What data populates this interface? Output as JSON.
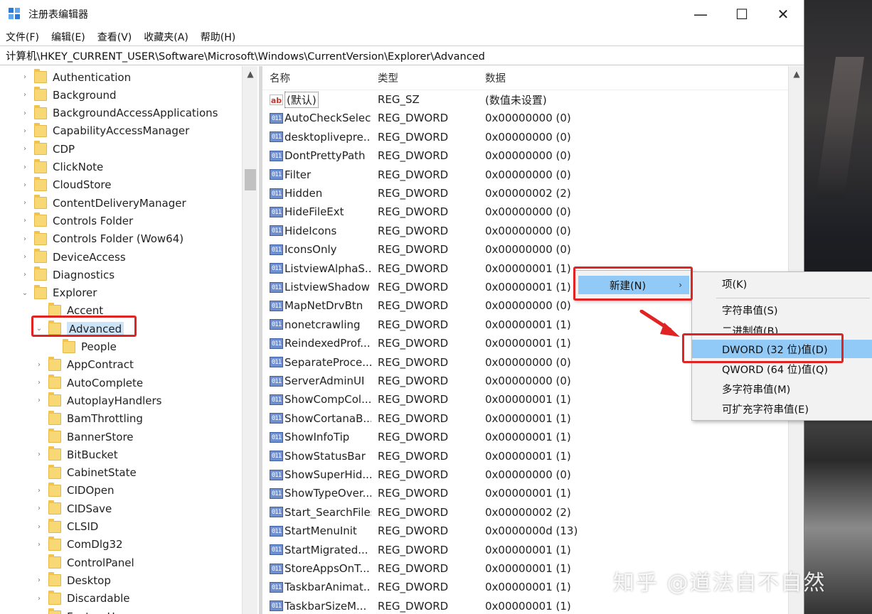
{
  "window": {
    "title": "注册表编辑器",
    "controls": [
      "—",
      "☐",
      "✕"
    ]
  },
  "menubar": [
    "文件(F)",
    "编辑(E)",
    "查看(V)",
    "收藏夹(A)",
    "帮助(H)"
  ],
  "address": "计算机\\HKEY_CURRENT_USER\\Software\\Microsoft\\Windows\\CurrentVersion\\Explorer\\Advanced",
  "tree": [
    {
      "label": "Authentication",
      "level": 1,
      "arrow": "›"
    },
    {
      "label": "Background",
      "level": 1,
      "arrow": "›"
    },
    {
      "label": "BackgroundAccessApplications",
      "level": 1,
      "arrow": "›"
    },
    {
      "label": "CapabilityAccessManager",
      "level": 1,
      "arrow": "›"
    },
    {
      "label": "CDP",
      "level": 1,
      "arrow": "›"
    },
    {
      "label": "ClickNote",
      "level": 1,
      "arrow": "›"
    },
    {
      "label": "CloudStore",
      "level": 1,
      "arrow": "›"
    },
    {
      "label": "ContentDeliveryManager",
      "level": 1,
      "arrow": "›"
    },
    {
      "label": "Controls Folder",
      "level": 1,
      "arrow": "›"
    },
    {
      "label": "Controls Folder (Wow64)",
      "level": 1,
      "arrow": "›"
    },
    {
      "label": "DeviceAccess",
      "level": 1,
      "arrow": "›"
    },
    {
      "label": "Diagnostics",
      "level": 1,
      "arrow": "›"
    },
    {
      "label": "Explorer",
      "level": 1,
      "arrow": "⌄"
    },
    {
      "label": "Accent",
      "level": 2,
      "arrow": ""
    },
    {
      "label": "Advanced",
      "level": 2,
      "arrow": "⌄"
    },
    {
      "label": "People",
      "level": 3,
      "arrow": ""
    },
    {
      "label": "AppContract",
      "level": 2,
      "arrow": "›"
    },
    {
      "label": "AutoComplete",
      "level": 2,
      "arrow": "›"
    },
    {
      "label": "AutoplayHandlers",
      "level": 2,
      "arrow": "›"
    },
    {
      "label": "BamThrottling",
      "level": 2,
      "arrow": ""
    },
    {
      "label": "BannerStore",
      "level": 2,
      "arrow": ""
    },
    {
      "label": "BitBucket",
      "level": 2,
      "arrow": "›"
    },
    {
      "label": "CabinetState",
      "level": 2,
      "arrow": ""
    },
    {
      "label": "CIDOpen",
      "level": 2,
      "arrow": "›"
    },
    {
      "label": "CIDSave",
      "level": 2,
      "arrow": "›"
    },
    {
      "label": "CLSID",
      "level": 2,
      "arrow": "›"
    },
    {
      "label": "ComDlg32",
      "level": 2,
      "arrow": "›"
    },
    {
      "label": "ControlPanel",
      "level": 2,
      "arrow": ""
    },
    {
      "label": "Desktop",
      "level": 2,
      "arrow": "›"
    },
    {
      "label": "Discardable",
      "level": 2,
      "arrow": "›"
    },
    {
      "label": "FeatureUsage",
      "level": 2,
      "arrow": "›"
    }
  ],
  "columns": {
    "name": "名称",
    "type": "类型",
    "data": "数据"
  },
  "values": [
    {
      "icon": "sz",
      "name": "(默认)",
      "type": "REG_SZ",
      "data": "(数值未设置)"
    },
    {
      "icon": "dword",
      "name": "AutoCheckSelect",
      "type": "REG_DWORD",
      "data": "0x00000000 (0)"
    },
    {
      "icon": "dword",
      "name": "desktoplivepre...",
      "type": "REG_DWORD",
      "data": "0x00000000 (0)"
    },
    {
      "icon": "dword",
      "name": "DontPrettyPath",
      "type": "REG_DWORD",
      "data": "0x00000000 (0)"
    },
    {
      "icon": "dword",
      "name": "Filter",
      "type": "REG_DWORD",
      "data": "0x00000000 (0)"
    },
    {
      "icon": "dword",
      "name": "Hidden",
      "type": "REG_DWORD",
      "data": "0x00000002 (2)"
    },
    {
      "icon": "dword",
      "name": "HideFileExt",
      "type": "REG_DWORD",
      "data": "0x00000000 (0)"
    },
    {
      "icon": "dword",
      "name": "HideIcons",
      "type": "REG_DWORD",
      "data": "0x00000000 (0)"
    },
    {
      "icon": "dword",
      "name": "IconsOnly",
      "type": "REG_DWORD",
      "data": "0x00000000 (0)"
    },
    {
      "icon": "dword",
      "name": "ListviewAlphaS...",
      "type": "REG_DWORD",
      "data": "0x00000001 (1)"
    },
    {
      "icon": "dword",
      "name": "ListviewShadow",
      "type": "REG_DWORD",
      "data": "0x00000001 (1)"
    },
    {
      "icon": "dword",
      "name": "MapNetDrvBtn",
      "type": "REG_DWORD",
      "data": "0x00000000 (0)"
    },
    {
      "icon": "dword",
      "name": "nonetcrawling",
      "type": "REG_DWORD",
      "data": "0x00000001 (1)"
    },
    {
      "icon": "dword",
      "name": "ReindexedProf...",
      "type": "REG_DWORD",
      "data": "0x00000001 (1)"
    },
    {
      "icon": "dword",
      "name": "SeparateProce...",
      "type": "REG_DWORD",
      "data": "0x00000000 (0)"
    },
    {
      "icon": "dword",
      "name": "ServerAdminUI",
      "type": "REG_DWORD",
      "data": "0x00000000 (0)"
    },
    {
      "icon": "dword",
      "name": "ShowCompCol...",
      "type": "REG_DWORD",
      "data": "0x00000001 (1)"
    },
    {
      "icon": "dword",
      "name": "ShowCortanaB...",
      "type": "REG_DWORD",
      "data": "0x00000001 (1)"
    },
    {
      "icon": "dword",
      "name": "ShowInfoTip",
      "type": "REG_DWORD",
      "data": "0x00000001 (1)"
    },
    {
      "icon": "dword",
      "name": "ShowStatusBar",
      "type": "REG_DWORD",
      "data": "0x00000001 (1)"
    },
    {
      "icon": "dword",
      "name": "ShowSuperHid...",
      "type": "REG_DWORD",
      "data": "0x00000000 (0)"
    },
    {
      "icon": "dword",
      "name": "ShowTypeOver...",
      "type": "REG_DWORD",
      "data": "0x00000001 (1)"
    },
    {
      "icon": "dword",
      "name": "Start_SearchFiles",
      "type": "REG_DWORD",
      "data": "0x00000002 (2)"
    },
    {
      "icon": "dword",
      "name": "StartMenuInit",
      "type": "REG_DWORD",
      "data": "0x0000000d (13)"
    },
    {
      "icon": "dword",
      "name": "StartMigrated...",
      "type": "REG_DWORD",
      "data": "0x00000001 (1)"
    },
    {
      "icon": "dword",
      "name": "StoreAppsOnT...",
      "type": "REG_DWORD",
      "data": "0x00000001 (1)"
    },
    {
      "icon": "dword",
      "name": "TaskbarAnimat...",
      "type": "REG_DWORD",
      "data": "0x00000001 (1)"
    },
    {
      "icon": "dword",
      "name": "TaskbarSizeM...",
      "type": "REG_DWORD",
      "data": "0x00000001 (1)"
    }
  ],
  "context_menu": {
    "new_label": "新建(N)",
    "submenu": [
      "项(K)",
      "字符串值(S)",
      "二进制值(B)",
      "DWORD (32 位)值(D)",
      "QWORD (64 位)值(Q)",
      "多字符串值(M)",
      "可扩充字符串值(E)"
    ]
  },
  "watermark": "知乎 @道法自不自然",
  "colors": {
    "highlight": "#91c9f7",
    "annotation": "#e02424",
    "selected": "#cce4f7"
  }
}
